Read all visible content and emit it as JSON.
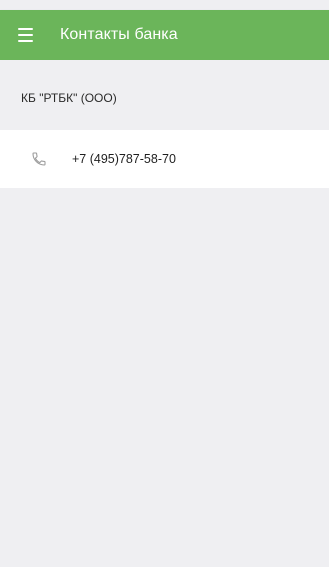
{
  "app_bar": {
    "title": "Контакты банка",
    "menu_icon": "hamburger-menu-icon",
    "background_color": "#6bb55a",
    "text_color": "#ffffff"
  },
  "bank": {
    "name": "КБ \"РТБК\" (ООО)"
  },
  "contacts": [
    {
      "icon": "phone-icon",
      "value": "+7 (495)787-58-70"
    }
  ],
  "colors": {
    "page_background": "#efeff2",
    "row_background": "#ffffff",
    "icon_color": "#9a9a9a"
  }
}
